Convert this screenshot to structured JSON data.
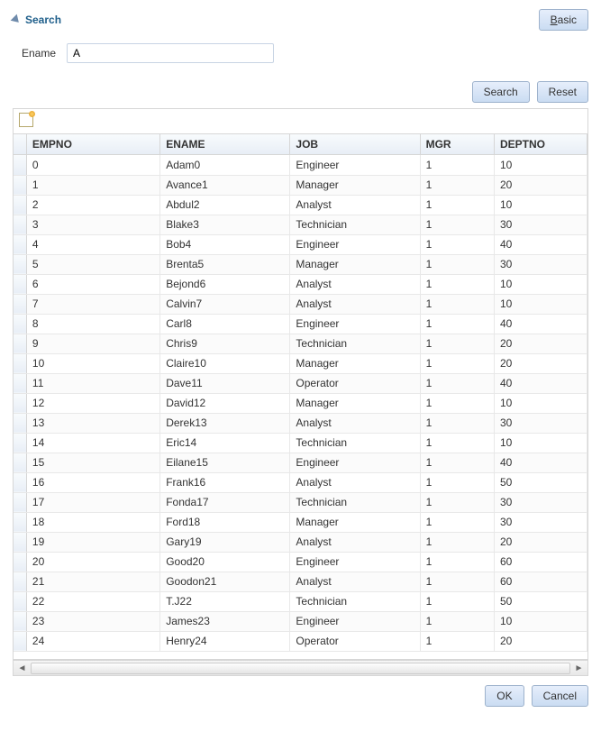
{
  "header": {
    "title": "Search",
    "basic_button": "Basic",
    "basic_button_access": "B"
  },
  "form": {
    "ename_label": "Ename",
    "ename_value": "A"
  },
  "actions": {
    "search_button": "Search",
    "reset_button": "Reset"
  },
  "table": {
    "columns": [
      "EMPNO",
      "ENAME",
      "JOB",
      "MGR",
      "DEPTNO"
    ],
    "rows": [
      {
        "empno": "0",
        "ename": "Adam0",
        "job": "Engineer",
        "mgr": "1",
        "deptno": "10"
      },
      {
        "empno": "1",
        "ename": "Avance1",
        "job": "Manager",
        "mgr": "1",
        "deptno": "20"
      },
      {
        "empno": "2",
        "ename": "Abdul2",
        "job": "Analyst",
        "mgr": "1",
        "deptno": "10"
      },
      {
        "empno": "3",
        "ename": "Blake3",
        "job": "Technician",
        "mgr": "1",
        "deptno": "30"
      },
      {
        "empno": "4",
        "ename": "Bob4",
        "job": "Engineer",
        "mgr": "1",
        "deptno": "40"
      },
      {
        "empno": "5",
        "ename": "Brenta5",
        "job": "Manager",
        "mgr": "1",
        "deptno": "30"
      },
      {
        "empno": "6",
        "ename": "Bejond6",
        "job": "Analyst",
        "mgr": "1",
        "deptno": "10"
      },
      {
        "empno": "7",
        "ename": "Calvin7",
        "job": "Analyst",
        "mgr": "1",
        "deptno": "10"
      },
      {
        "empno": "8",
        "ename": "Carl8",
        "job": "Engineer",
        "mgr": "1",
        "deptno": "40"
      },
      {
        "empno": "9",
        "ename": "Chris9",
        "job": "Technician",
        "mgr": "1",
        "deptno": "20"
      },
      {
        "empno": "10",
        "ename": "Claire10",
        "job": "Manager",
        "mgr": "1",
        "deptno": "20"
      },
      {
        "empno": "11",
        "ename": "Dave11",
        "job": "Operator",
        "mgr": "1",
        "deptno": "40"
      },
      {
        "empno": "12",
        "ename": "David12",
        "job": "Manager",
        "mgr": "1",
        "deptno": "10"
      },
      {
        "empno": "13",
        "ename": "Derek13",
        "job": "Analyst",
        "mgr": "1",
        "deptno": "30"
      },
      {
        "empno": "14",
        "ename": "Eric14",
        "job": "Technician",
        "mgr": "1",
        "deptno": "10"
      },
      {
        "empno": "15",
        "ename": "Eilane15",
        "job": "Engineer",
        "mgr": "1",
        "deptno": "40"
      },
      {
        "empno": "16",
        "ename": "Frank16",
        "job": "Analyst",
        "mgr": "1",
        "deptno": "50"
      },
      {
        "empno": "17",
        "ename": "Fonda17",
        "job": "Technician",
        "mgr": "1",
        "deptno": "30"
      },
      {
        "empno": "18",
        "ename": "Ford18",
        "job": "Manager",
        "mgr": "1",
        "deptno": "30"
      },
      {
        "empno": "19",
        "ename": "Gary19",
        "job": "Analyst",
        "mgr": "1",
        "deptno": "20"
      },
      {
        "empno": "20",
        "ename": "Good20",
        "job": "Engineer",
        "mgr": "1",
        "deptno": "60"
      },
      {
        "empno": "21",
        "ename": "Goodon21",
        "job": "Analyst",
        "mgr": "1",
        "deptno": "60"
      },
      {
        "empno": "22",
        "ename": "T.J22",
        "job": "Technician",
        "mgr": "1",
        "deptno": "50"
      },
      {
        "empno": "23",
        "ename": "James23",
        "job": "Engineer",
        "mgr": "1",
        "deptno": "10"
      },
      {
        "empno": "24",
        "ename": "Henry24",
        "job": "Operator",
        "mgr": "1",
        "deptno": "20"
      }
    ]
  },
  "footer": {
    "ok_button": "OK",
    "cancel_button": "Cancel"
  }
}
